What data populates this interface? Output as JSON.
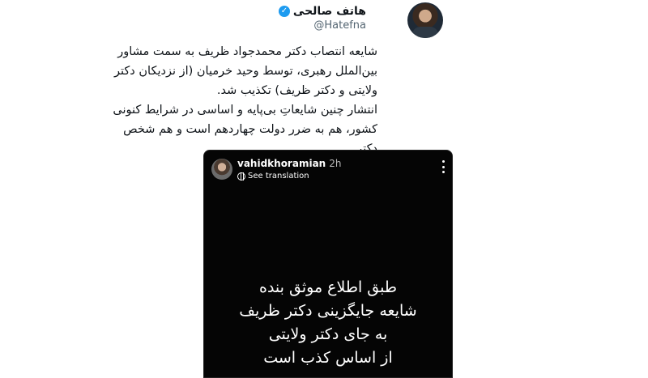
{
  "author": {
    "name": "هاتف صالحی",
    "handle": "@Hatefna",
    "verified_icon": "verified-badge-icon",
    "avatar_icon": "profile-avatar"
  },
  "tweet": {
    "text": "شایعه انتصاب دکتر محمدجواد ظریف به سمت مشاور\nبین‌الملل رهبری، توسط وحید خرمیان (از نزدیکان دکتر\nولایتی و دکتر ظریف) تکذیب شد.\nانتشار چنین شایعاتِ بی‌پایه و اساسی در شرایط کنونی\nکشور، هم به ضرر دولت چهاردهم است و هم شخص دکتر\nظریف."
  },
  "embedded_story": {
    "username": "vahidkhoramian",
    "time": "2h",
    "see_translation": "See translation",
    "more_icon": "more-vertical-icon",
    "text": "طبق اطلاع موثق بنده\nشایعه جایگزینی دکتر ظریف\nبه جای دکتر ولایتی\nاز اساس کذب است"
  },
  "colors": {
    "verified": "#1d9bf0",
    "story_background": "#050505",
    "secondary_text": "#536471"
  }
}
